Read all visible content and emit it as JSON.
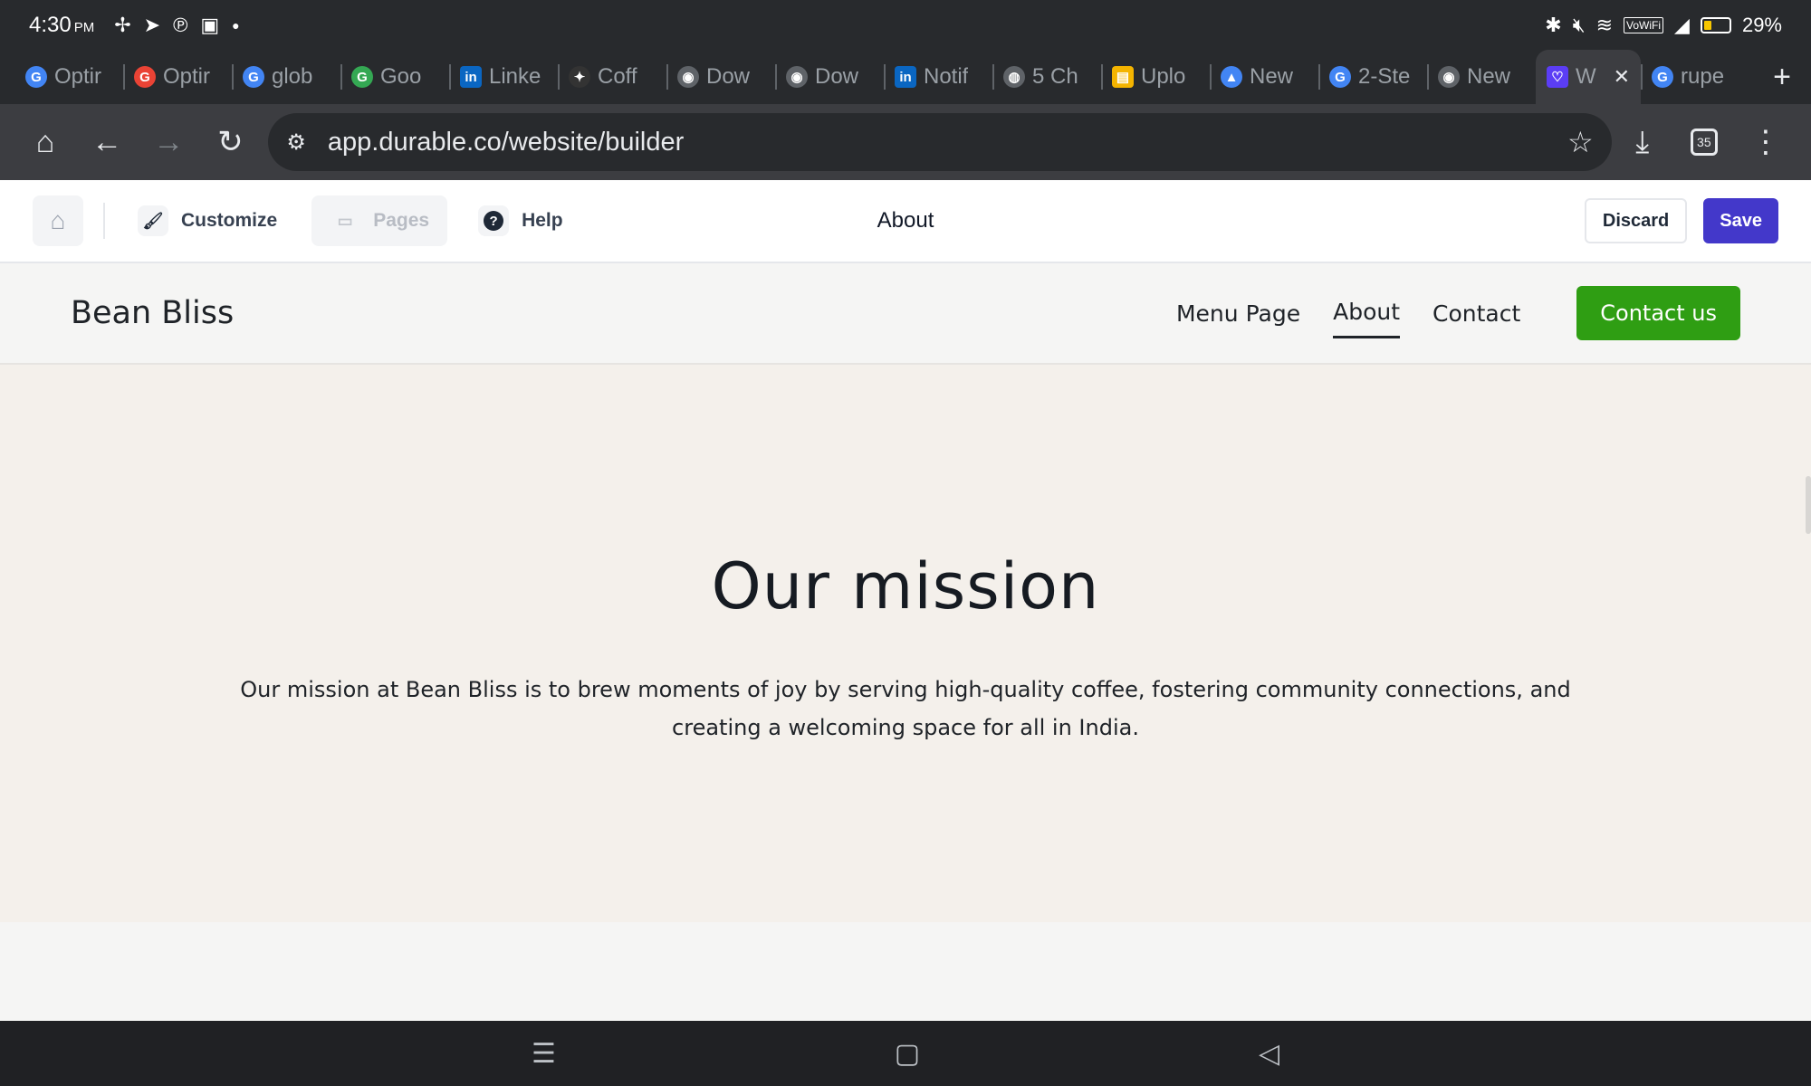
{
  "status": {
    "time": "4:30",
    "ampm": "PM",
    "battery": "29%",
    "vowifi": "VoWiFi"
  },
  "tabs": [
    {
      "label": "Optir",
      "fav": "G",
      "color": "#4285f4"
    },
    {
      "label": "Optir",
      "fav": "G",
      "color": "#ea4335"
    },
    {
      "label": "glob",
      "fav": "G",
      "color": "#4285f4"
    },
    {
      "label": "Goo",
      "fav": "G",
      "color": "#34a853"
    },
    {
      "label": "Linke",
      "fav": "in",
      "color": "#0a66c2"
    },
    {
      "label": "Coff",
      "fav": "✦",
      "color": "#333"
    },
    {
      "label": "Dow",
      "fav": "◉",
      "color": "#5f6368"
    },
    {
      "label": "Dow",
      "fav": "◉",
      "color": "#5f6368"
    },
    {
      "label": "Notif",
      "fav": "in",
      "color": "#0a66c2"
    },
    {
      "label": "5 Ch",
      "fav": "◍",
      "color": "#5f6368"
    },
    {
      "label": "Uplo",
      "fav": "▤",
      "color": "#f4b400"
    },
    {
      "label": "New",
      "fav": "▲",
      "color": "#4285f4"
    },
    {
      "label": "2-Ste",
      "fav": "G",
      "color": "#4285f4"
    },
    {
      "label": "New",
      "fav": "◉",
      "color": "#5f6368"
    },
    {
      "label": "W",
      "fav": "♡",
      "color": "#5b3df5"
    },
    {
      "label": "rupe",
      "fav": "G",
      "color": "#4285f4"
    }
  ],
  "browser": {
    "url": "app.durable.co/website/builder",
    "tab_count": "35"
  },
  "builder": {
    "customize": "Customize",
    "pages": "Pages",
    "help": "Help",
    "current_page": "About",
    "discard": "Discard",
    "save": "Save",
    "accent": "#4338ca"
  },
  "site": {
    "brand": "Bean Bliss",
    "nav": {
      "menu": "Menu Page",
      "about": "About",
      "contact": "Contact",
      "cta": "Contact us"
    },
    "cta_color": "#2f9e13",
    "mission_title": "Our mission",
    "mission_text": "Our mission at Bean Bliss is to brew moments of joy by serving high-quality coffee, fostering community connections, and creating a welcoming space for all in India."
  }
}
